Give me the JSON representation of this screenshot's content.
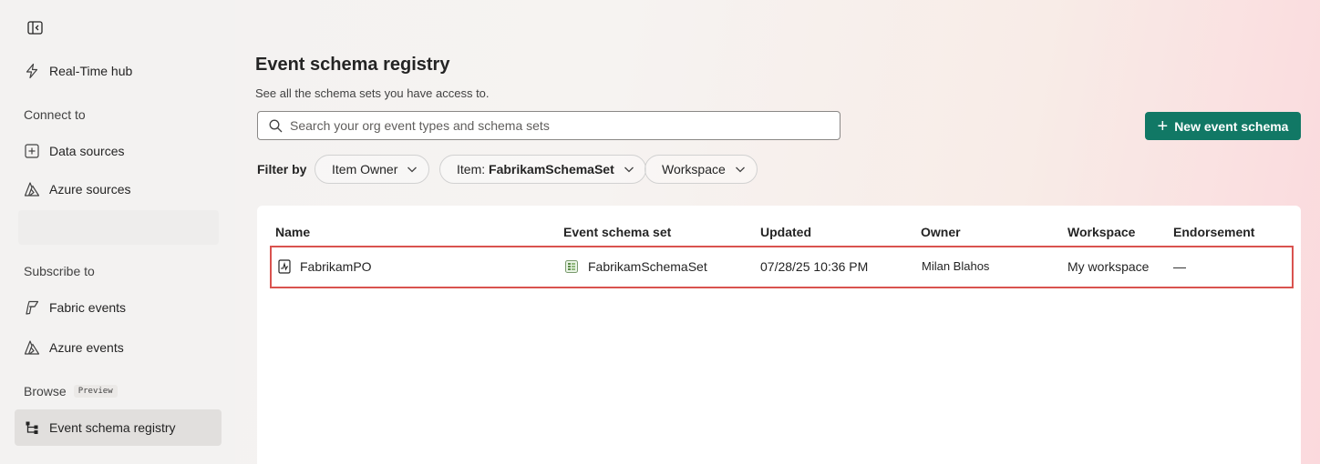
{
  "sidebar": {
    "items": [
      {
        "label": "Real-Time hub",
        "icon": "lightning-icon"
      },
      {
        "label": "Data sources",
        "icon": "plus-square-icon"
      },
      {
        "label": "Azure sources",
        "icon": "azure-icon"
      },
      {
        "label": "Fabric events",
        "icon": "fabric-icon"
      },
      {
        "label": "Azure events",
        "icon": "azure-icon"
      },
      {
        "label": "Event schema registry",
        "icon": "schema-tree-icon",
        "active": true
      }
    ],
    "sections": {
      "connect_to": "Connect to",
      "subscribe_to": "Subscribe to",
      "browse": "Browse",
      "browse_badge": "Preview"
    }
  },
  "main": {
    "title": "Event schema registry",
    "subtitle": "See all the schema sets you have access to.",
    "search": {
      "placeholder": "Search your org event types and schema sets"
    },
    "new_button": "New event schema",
    "filter": {
      "label": "Filter by",
      "item_owner": "Item Owner",
      "item_prefix": "Item: ",
      "item_value": "FabrikamSchemaSet",
      "workspace": "Workspace"
    },
    "table": {
      "headers": [
        "Name",
        "Event schema set",
        "Updated",
        "Owner",
        "Workspace",
        "Endorsement"
      ],
      "rows": [
        {
          "name": "FabrikamPO",
          "schema_set": "FabrikamSchemaSet",
          "updated": "07/28/25 10:36 PM",
          "owner": "Milan Blahos",
          "workspace": "My workspace",
          "endorsement": "—"
        }
      ]
    }
  },
  "colors": {
    "accent": "#117865",
    "highlight": "#d9534f",
    "active_nav": "#e1dfdd"
  }
}
